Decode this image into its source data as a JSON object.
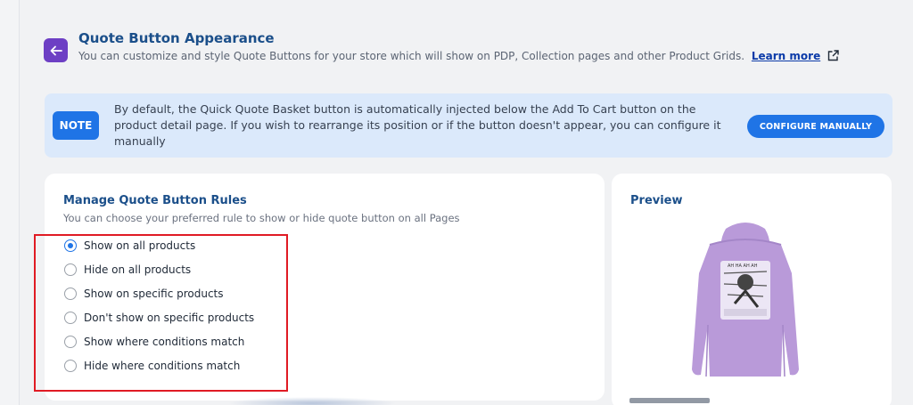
{
  "header": {
    "title": "Quote Button Appearance",
    "subtitle": "You can customize and style Quote Buttons for your store which will show on PDP, Collection pages and other Product Grids.",
    "learn_more": "Learn more"
  },
  "note": {
    "badge": "NOTE",
    "text": "By default, the Quick Quote Basket button is automatically injected below the Add To Cart button on the product detail page. If you wish to rearrange its position or if the button doesn't appear, you can configure it manually",
    "button_label": "CONFIGURE MANUALLY"
  },
  "rules": {
    "title": "Manage Quote Button Rules",
    "subtitle": "You can choose your preferred rule to show or hide quote button on all Pages",
    "options": [
      {
        "label": "Show on all products",
        "selected": true
      },
      {
        "label": "Hide on all products",
        "selected": false
      },
      {
        "label": "Show on specific products",
        "selected": false
      },
      {
        "label": "Don't show on specific products",
        "selected": false
      },
      {
        "label": "Show where conditions match",
        "selected": false
      },
      {
        "label": "Hide where conditions match",
        "selected": false
      }
    ]
  },
  "preview": {
    "title": "Preview"
  },
  "colors": {
    "accent": "#1f74e6",
    "brand_purple": "#6d3fc4",
    "heading": "#1b4f8a",
    "note_bg": "#dbe9fb",
    "highlight": "#e01b24",
    "hoodie": "#b99ad9"
  }
}
